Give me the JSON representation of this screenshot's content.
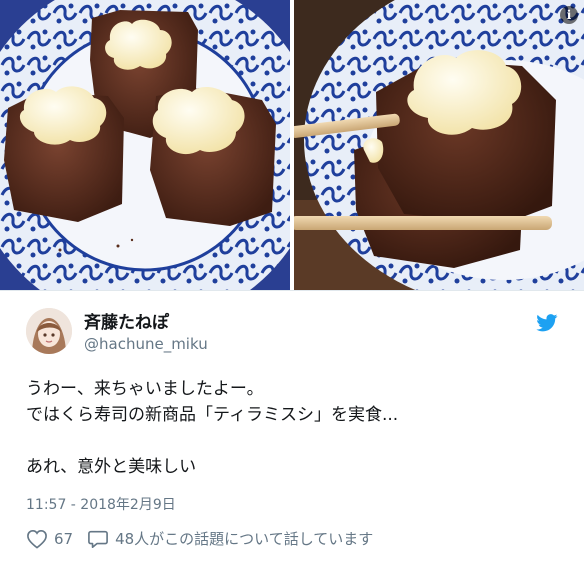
{
  "tweet": {
    "display_name": "斉藤たねぽ",
    "handle": "@hachune_miku",
    "text_lines": [
      "うわー、来ちゃいましたよー。",
      "ではくら寿司の新商品「ティラミスシ」を実食...",
      "",
      "あれ、意外と美味しい"
    ],
    "timestamp": "11:57 - 2018年2月9日",
    "likes_count": "67",
    "conversation_text": "48人がこの話題について話しています"
  },
  "icons": {
    "info": "info-icon",
    "brand": "twitter-bird-icon",
    "like": "heart-icon",
    "reply": "speech-bubble-icon"
  },
  "colors": {
    "twitter_blue": "#1da1f2",
    "secondary_text": "#657786",
    "plate_blue": "#1f3f9c",
    "cake_brown": "#5a2e1c",
    "cream": "#fff6d8"
  }
}
